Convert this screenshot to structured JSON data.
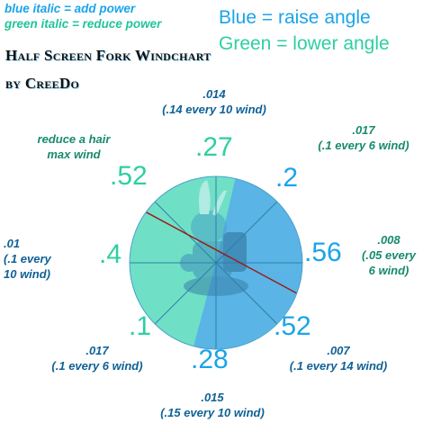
{
  "legend": {
    "blue_italic": "blue italic = add power",
    "green_italic": "green italic = reduce power"
  },
  "rules": {
    "blue": "Blue = raise angle",
    "green": "Green = lower angle"
  },
  "title": {
    "line1": "Half Screen Fork Windchart",
    "line2": "by CreeDo"
  },
  "chart": {
    "center_note": [
      "reduce a hair",
      "max wind"
    ],
    "directions": [
      {
        "key": "n",
        "value": ".27",
        "value_color": "green",
        "note": [
          ".014",
          "(.14 every 10 wind)"
        ],
        "note_color": "blue"
      },
      {
        "key": "ne",
        "value": ".2",
        "value_color": "blue",
        "note": [
          ".017",
          "(.1 every 6 wind)"
        ],
        "note_color": "green"
      },
      {
        "key": "e",
        "value": ".56",
        "value_color": "blue",
        "note": [
          ".008",
          "(.05 every",
          "6 wind)"
        ],
        "note_color": "green"
      },
      {
        "key": "se",
        "value": ".52",
        "value_color": "blue",
        "note": [
          ".007",
          "(.1 every 14 wind)"
        ],
        "note_color": "blue"
      },
      {
        "key": "s",
        "value": ".28",
        "value_color": "blue",
        "note": [
          ".015",
          "(.15 every 10 wind)"
        ],
        "note_color": "blue"
      },
      {
        "key": "sw",
        "value": ".1",
        "value_color": "green",
        "note": [
          ".017",
          "(.1 every 6 wind)"
        ],
        "note_color": "blue"
      },
      {
        "key": "w",
        "value": ".4",
        "value_color": "green",
        "note": [
          ".01",
          "(.1 every",
          "10 wind)"
        ],
        "note_color": "blue"
      },
      {
        "key": "nw",
        "value": ".52",
        "value_color": "green",
        "note": [],
        "note_color": "green"
      }
    ],
    "colors": {
      "blue_region": "#5ab4e6",
      "green_region": "#6fe0c6",
      "spoke": "#2e7fa8",
      "diagonal": "#9a1c1c"
    }
  }
}
